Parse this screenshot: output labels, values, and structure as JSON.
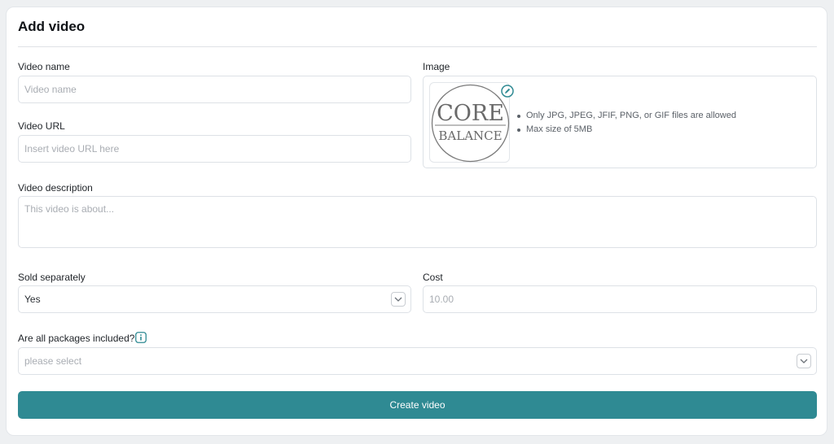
{
  "form": {
    "title": "Add video",
    "video_name": {
      "label": "Video name",
      "placeholder": "Video name",
      "value": ""
    },
    "video_url": {
      "label": "Video URL",
      "placeholder": "Insert video URL here",
      "value": ""
    },
    "image": {
      "label": "Image",
      "logo_text_top": "CORE",
      "logo_text_bottom": "BALANCE",
      "rules": [
        "Only JPG, JPEG, JFIF, PNG, or GIF files are allowed",
        "Max size of 5MB"
      ]
    },
    "video_description": {
      "label": "Video description",
      "placeholder": "This video is about...",
      "value": ""
    },
    "sold_separately": {
      "label": "Sold separately",
      "value": "Yes"
    },
    "cost": {
      "label": "Cost",
      "placeholder": "10.00",
      "value": ""
    },
    "packages": {
      "label": "Are all packages included?",
      "placeholder": "please select"
    },
    "submit_label": "Create video"
  },
  "colors": {
    "primary": "#2f8a93",
    "border": "#dde1e6",
    "placeholder": "#a9adb3"
  },
  "icons": {
    "edit": "pencil-icon",
    "info": "info-icon",
    "chevron": "chevron-down-icon"
  }
}
